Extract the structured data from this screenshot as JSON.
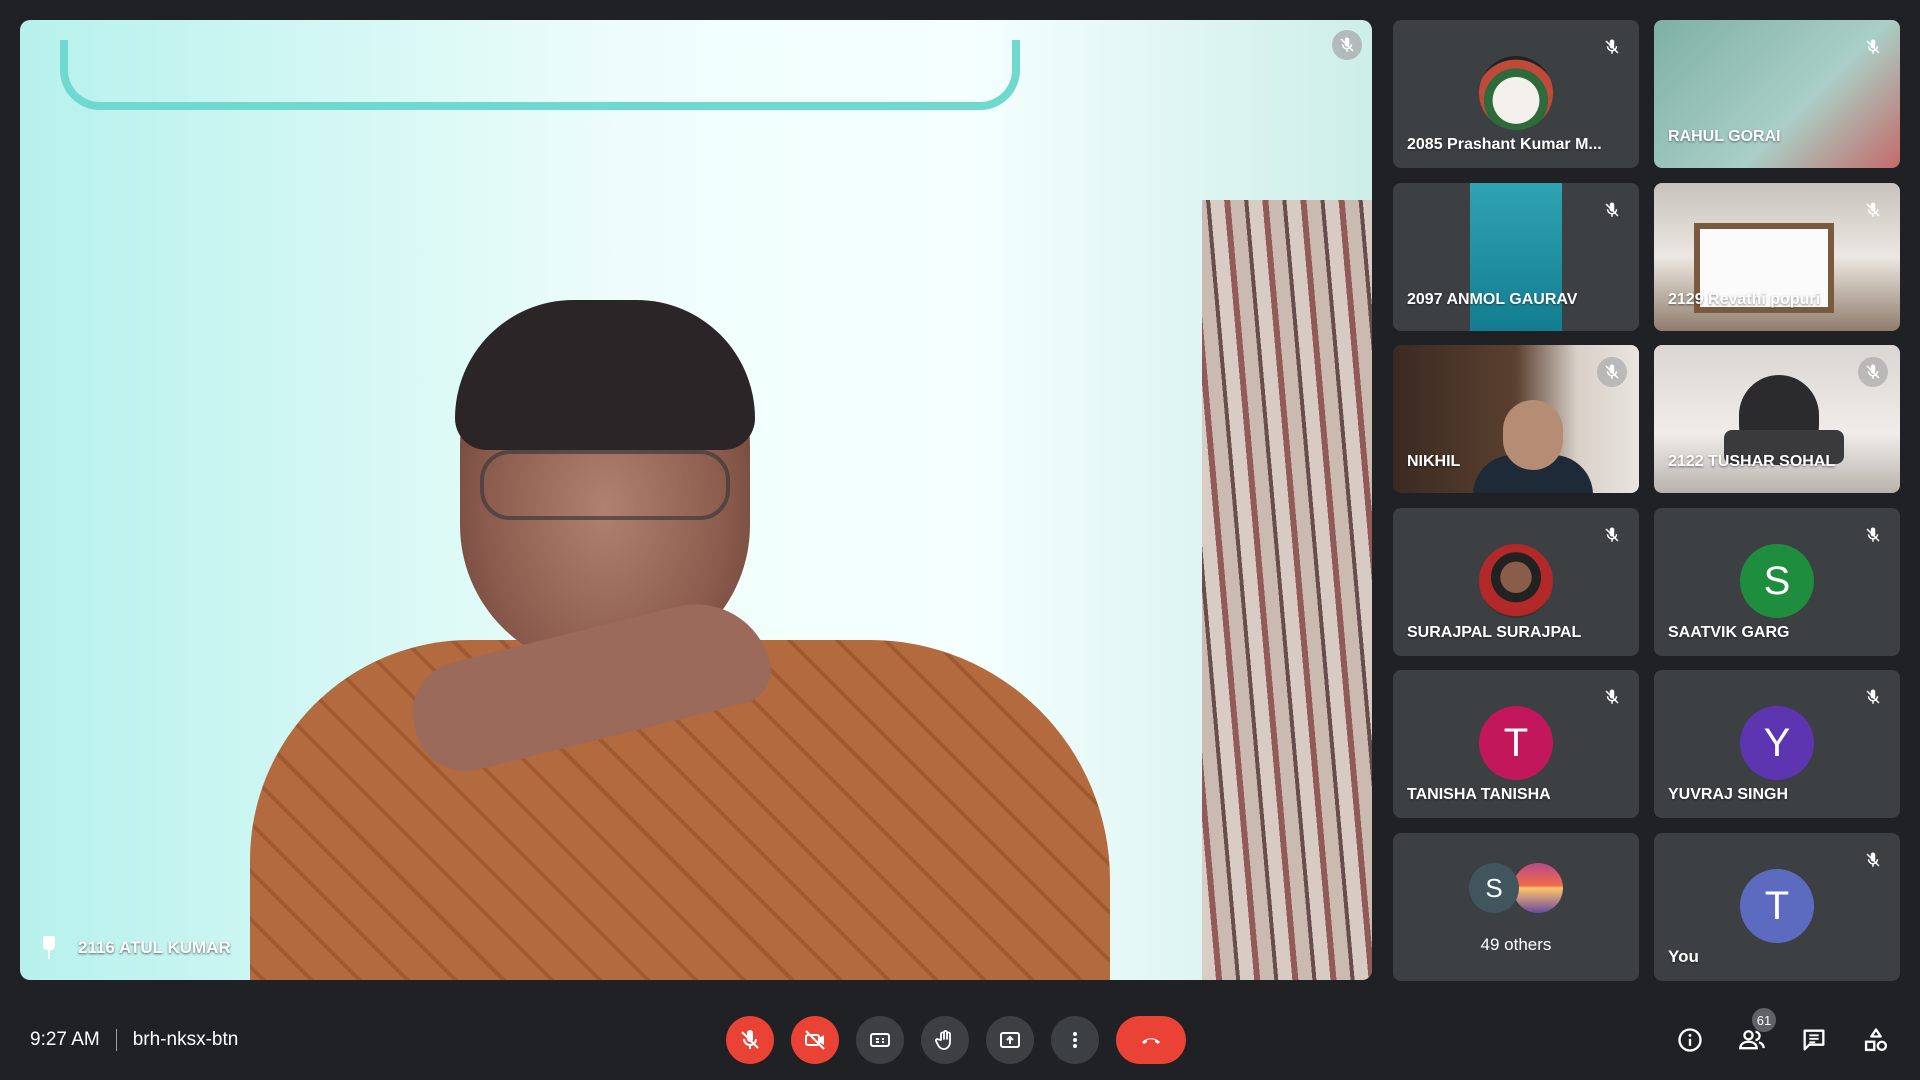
{
  "main": {
    "presenter_name": "2116 ATUL KUMAR"
  },
  "tiles": [
    {
      "name": "2085 Prashant Kumar M...",
      "avatar": "photo"
    },
    {
      "name": "RAHUL GORAI",
      "avatar": "video"
    },
    {
      "name": "2097 ANMOL GAURAV",
      "avatar": "video"
    },
    {
      "name": "2129 Revathi popuri",
      "avatar": "video"
    },
    {
      "name": "NIKHIL",
      "avatar": "video"
    },
    {
      "name": "2122 TUSHAR SOHAL",
      "avatar": "video"
    },
    {
      "name": "SURAJPAL SURAJPAL",
      "avatar": "photo"
    },
    {
      "name": "SAATVIK GARG",
      "initial": "S",
      "color": "#1e8e3e"
    },
    {
      "name": "TANISHA TANISHA",
      "initial": "T",
      "color": "#c2185b"
    },
    {
      "name": "YUVRAJ SINGH",
      "initial": "Y",
      "color": "#5e35b1"
    },
    {
      "name": "You",
      "initial": "T",
      "color": "#5c6bc0"
    }
  ],
  "others": {
    "label": "49 others",
    "initial": "S"
  },
  "bottom_bar": {
    "time": "9:27 AM",
    "meeting_code": "brh-nksx-btn",
    "participant_count": "61"
  },
  "colors": {
    "background": "#202124",
    "tile": "#3c4043",
    "danger": "#ea4335"
  }
}
